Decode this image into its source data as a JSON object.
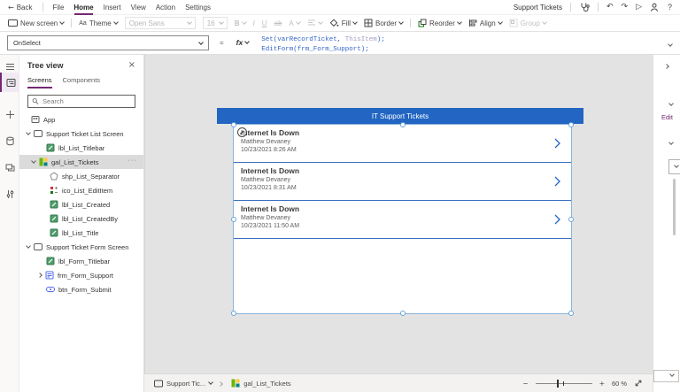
{
  "menu": {
    "back": "Back",
    "items": [
      "File",
      "Home",
      "Insert",
      "View",
      "Action",
      "Settings"
    ],
    "active_item": "Home",
    "app_name": "Support Tickets"
  },
  "toolbar": {
    "new_screen": "New screen",
    "theme": "Theme",
    "font_name": "Open Sans",
    "font_size": "16",
    "bold": "B",
    "italic": "I",
    "underline": "U",
    "strikethrough": "ab",
    "font_color": "A",
    "fill": "Fill",
    "border": "Border",
    "reorder": "Reorder",
    "align": "Align",
    "group": "Group"
  },
  "formula_bar": {
    "property": "OnSelect",
    "equals": "=",
    "fx": "fx",
    "line1": [
      {
        "text": "Set(varRecordTicket, "
      },
      {
        "text": "ThisItem"
      },
      {
        "text": ");"
      }
    ],
    "line2": "EditForm(frm_Form_Support);"
  },
  "tree_panel": {
    "title": "Tree view",
    "tabs": [
      "Screens",
      "Components"
    ],
    "active_tab": "Screens",
    "search_placeholder": "Search",
    "items": [
      {
        "label": "App",
        "type": "app"
      },
      {
        "label": "Support Ticket List Screen",
        "type": "screen"
      },
      {
        "label": "lbl_List_Titlebar",
        "type": "label"
      },
      {
        "label": "gal_List_Tickets",
        "type": "gallery",
        "selected": true
      },
      {
        "label": "shp_List_Separator",
        "type": "shape"
      },
      {
        "label": "ico_List_EditItem",
        "type": "icon"
      },
      {
        "label": "lbl_List_Created",
        "type": "label"
      },
      {
        "label": "lbl_List_CreatedBy",
        "type": "label"
      },
      {
        "label": "lbl_List_Title",
        "type": "label"
      },
      {
        "label": "Support Ticket Form Screen",
        "type": "screen"
      },
      {
        "label": "lbl_Form_Titlebar",
        "type": "label"
      },
      {
        "label": "frm_Form_Support",
        "type": "form"
      },
      {
        "label": "btn_Form_Submit",
        "type": "button"
      }
    ]
  },
  "canvas": {
    "screen_title": "IT Support Tickets",
    "gallery": {
      "items": [
        {
          "title": "Internet Is Down",
          "author": "Matthew Devaney",
          "created": "10/23/2021 8:26 AM"
        },
        {
          "title": "Internet Is Down",
          "author": "Matthew Devaney",
          "created": "10/23/2021 8:31 AM"
        },
        {
          "title": "Internet Is Down",
          "author": "Matthew Devaney",
          "created": "10/23/2021 11:50 AM"
        }
      ]
    }
  },
  "right_panel": {
    "edit_link": "Edit"
  },
  "status_bar": {
    "screen_selector": "Support Tic...",
    "selected_control": "gal_List_Tickets",
    "zoom_level": "60",
    "zoom_unit": "%"
  },
  "icons": {
    "back_arrow": "←",
    "undo": "↶",
    "redo": "↷",
    "play": "▷",
    "help": "?",
    "close": "×",
    "more": "···",
    "minus": "−",
    "plus": "+",
    "theme_glyph": "Aa"
  },
  "colors": {
    "accent_purple": "#742774",
    "titlebar_blue": "#2265c2",
    "item_separator_blue": "#3a6fc0",
    "selection_handle_blue": "#66a4d8",
    "formula_function": "#3465c8",
    "formula_thisitem": "#a89bc4"
  }
}
